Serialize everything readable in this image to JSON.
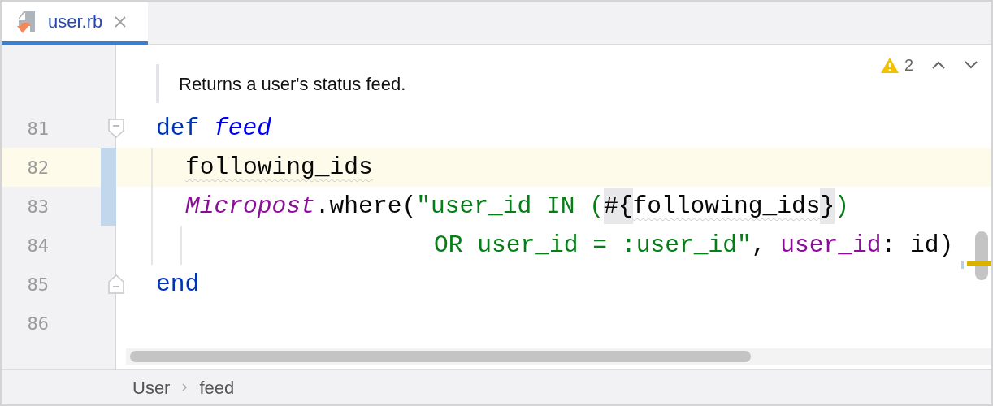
{
  "tabs": [
    {
      "label": "user.rb",
      "selected": true
    }
  ],
  "doc_comment": "Returns a user's status feed.",
  "inspections": {
    "count": "2"
  },
  "lines": [
    {
      "number": "81",
      "kind": "definition",
      "current": false,
      "changed": false,
      "fold_start": true,
      "tokens": [
        {
          "kind": "keyword",
          "text": "def "
        },
        {
          "kind": "function",
          "text": "feed"
        }
      ]
    },
    {
      "number": "82",
      "kind": "body",
      "current": true,
      "changed": true,
      "tokens": [
        {
          "kind": "plain",
          "text": "following_ids",
          "warning": true
        }
      ]
    },
    {
      "number": "83",
      "kind": "body",
      "current": false,
      "changed": true,
      "tokens": [
        {
          "kind": "constant",
          "text": "Micropost"
        },
        {
          "kind": "plain",
          "text": ".where("
        },
        {
          "kind": "string",
          "text": "\"user_id IN ("
        },
        {
          "kind": "brace",
          "text": "#{"
        },
        {
          "kind": "plain",
          "text": "following_ids",
          "warning": true
        },
        {
          "kind": "brace",
          "text": "}"
        },
        {
          "kind": "string",
          "text": ")"
        }
      ]
    },
    {
      "number": "84",
      "kind": "continuation",
      "current": false,
      "changed": false,
      "tokens": [
        {
          "kind": "string",
          "text": "OR user_id = :user_id\""
        },
        {
          "kind": "plain",
          "text": ", "
        },
        {
          "kind": "symbol",
          "text": "user_id"
        },
        {
          "kind": "plain",
          "text": ": id)"
        }
      ]
    },
    {
      "number": "85",
      "kind": "definition",
      "current": false,
      "changed": false,
      "fold_end": true,
      "tokens": [
        {
          "kind": "keyword",
          "text": "end"
        }
      ]
    },
    {
      "number": "86",
      "kind": "definition",
      "current": false,
      "changed": false
    }
  ],
  "breadcrumbs": [
    "User",
    "feed"
  ]
}
